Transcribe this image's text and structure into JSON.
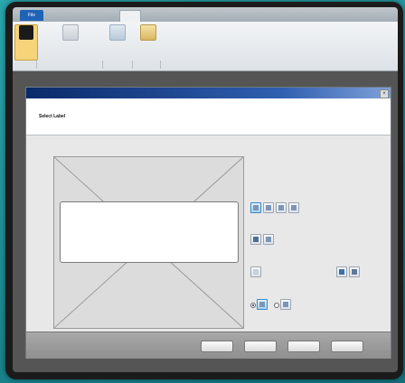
{
  "ribbon": {
    "tabs": [
      "File",
      "",
      "",
      "",
      "",
      ""
    ],
    "buttons": [
      "",
      "",
      "",
      ""
    ],
    "groups": [
      "",
      "",
      "",
      ""
    ]
  },
  "dialog": {
    "title": "",
    "heading": "Select Label",
    "description": ""
  },
  "options": {
    "section_a": "",
    "section_b": "",
    "section_c": "",
    "section_d": ""
  },
  "footer": {
    "cancel": "",
    "back": "",
    "next": "",
    "finish": ""
  },
  "colors": {
    "accent": "#1f63b6",
    "selected_button": "#f7d47a",
    "backdrop": "#1e8a92"
  }
}
